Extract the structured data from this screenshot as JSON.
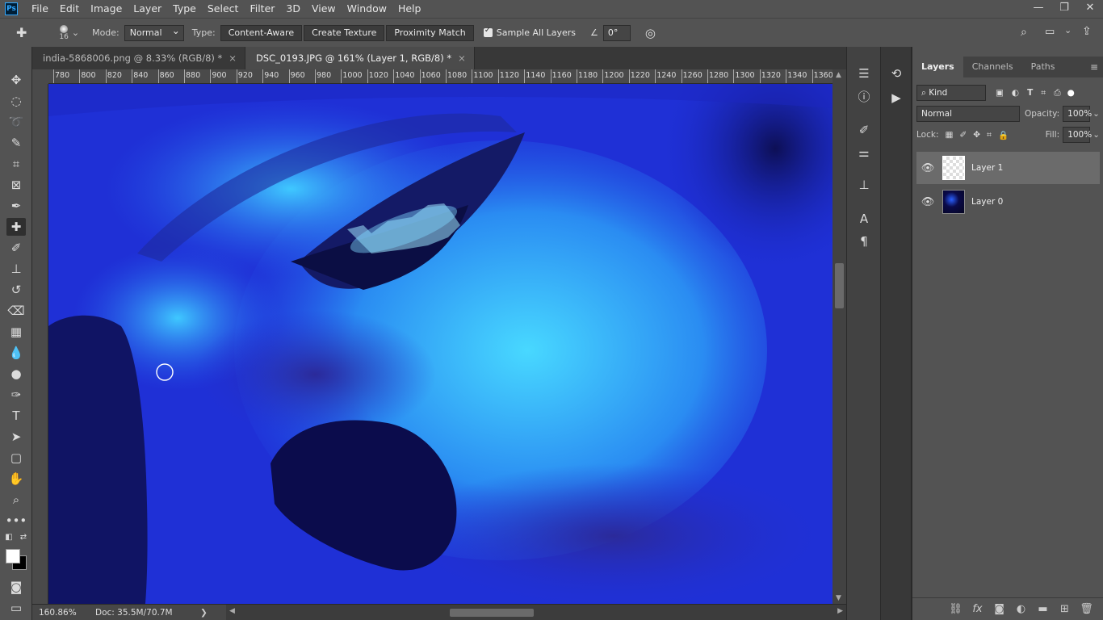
{
  "app": {
    "logo": "Ps"
  },
  "menu": [
    "File",
    "Edit",
    "Image",
    "Layer",
    "Type",
    "Select",
    "Filter",
    "3D",
    "View",
    "Window",
    "Help"
  ],
  "window_controls": {
    "minimize": "—",
    "restore": "❐",
    "close": "✕"
  },
  "options_bar": {
    "brush_size": "16",
    "mode_label": "Mode:",
    "mode_value": "Normal",
    "type_label": "Type:",
    "type_buttons": [
      "Content-Aware",
      "Create Texture",
      "Proximity Match"
    ],
    "sample_all_layers": "Sample All Layers",
    "angle": "0°"
  },
  "tabs": [
    {
      "label": "india-5868006.png @ 8.33% (RGB/8) *",
      "close": "×"
    },
    {
      "label": "DSC_0193.JPG @ 161% (Layer 1, RGB/8) *",
      "close": "×"
    }
  ],
  "ruler_h": [
    "780",
    "800",
    "820",
    "840",
    "860",
    "880",
    "900",
    "920",
    "940",
    "960",
    "980",
    "1000",
    "1020",
    "1040",
    "1060",
    "1080",
    "1100",
    "1120",
    "1140",
    "1160",
    "1180",
    "1200",
    "1220",
    "1240",
    "1260",
    "1280",
    "1300",
    "1320",
    "1340",
    "1360"
  ],
  "status": {
    "zoom": "160.86%",
    "doc": "Doc: 35.5M/70.7M",
    "arrow": "❯"
  },
  "panel": {
    "tabs": [
      "Layers",
      "Channels",
      "Paths"
    ],
    "filter_kind": "Kind",
    "blend_mode": "Normal",
    "opacity_label": "Opacity:",
    "opacity": "100%",
    "lock_label": "Lock:",
    "fill_label": "Fill:",
    "fill": "100%",
    "layers": [
      {
        "name": "Layer 1",
        "selected": true
      },
      {
        "name": "Layer 0",
        "selected": false
      }
    ]
  },
  "colors": {
    "canvas_blue": "#1d2bd8",
    "cyan": "#42c8ff",
    "ui_dark": "#535353"
  }
}
